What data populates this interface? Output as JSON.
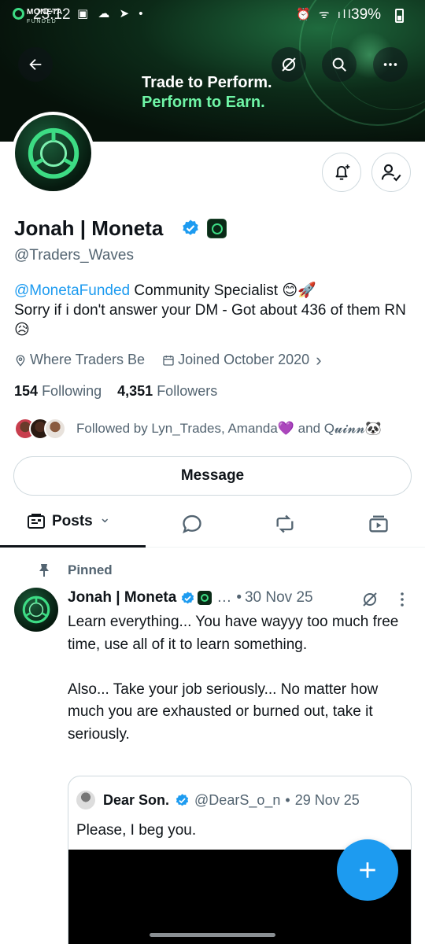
{
  "status_bar": {
    "time": "23:12",
    "battery": "39%",
    "brand_small": "MONETA",
    "brand_sub": "FUNDED",
    "left_icons": "▣ ☁ ➤ •",
    "right_icons": "⏰ ᯤ ıll"
  },
  "banner": {
    "line1": "Trade to Perform.",
    "line2": "Perform to Earn."
  },
  "profile": {
    "display_name": "Jonah | Moneta",
    "handle": "@Traders_Waves",
    "bio_mention": "@MonetaFunded",
    "bio_line1_rest": " Community Specialist 😊🚀",
    "bio_line2": "Sorry if i don't answer your DM - Got about 436 of them RN 😥",
    "location": "Where Traders Be",
    "joined": "Joined October 2020",
    "joined_chevron": "›",
    "following_count": "154",
    "following_label": "Following",
    "followers_count": "4,351",
    "followers_label": "Followers",
    "followed_by": "Followed by Lyn_Trades, Amanda💜 and Q𝓾𝓲𝓷𝓷🐼",
    "message_label": "Message"
  },
  "tabs": {
    "posts_label": "Posts",
    "posts_chevron": "⌄"
  },
  "post": {
    "pinned_label": "Pinned",
    "author": "Jonah | Moneta",
    "ellipsis": "…",
    "sep": "•",
    "date": "30 Nov 25",
    "text": "Learn everything... You have wayyy too much free time, use all of it to learn something.\n\nAlso... Take your job seriously... No matter how much you are exhausted or burned out, take it seriously.",
    "quote": {
      "author": "Dear Son.",
      "handle": "@DearS_o_n",
      "sep": "•",
      "date": "29 Nov 25",
      "text": "Please, I beg you."
    }
  },
  "colors": {
    "accent": "#1d9bf0",
    "brand_green": "#3ddc84",
    "text_primary": "#0f1419",
    "text_secondary": "#536471",
    "border": "#cfd9de"
  },
  "icons": {
    "back": "arrow-left-icon",
    "grok_off": "no-grok-icon",
    "search": "search-icon",
    "more": "more-horizontal-icon",
    "notify": "bell-plus-icon",
    "following": "person-check-icon",
    "location": "location-pin-icon",
    "calendar": "calendar-icon",
    "replies": "speech-bubble-icon",
    "reposts": "repost-icon",
    "media": "video-icon",
    "pin": "pin-icon",
    "compose": "plus-icon"
  }
}
